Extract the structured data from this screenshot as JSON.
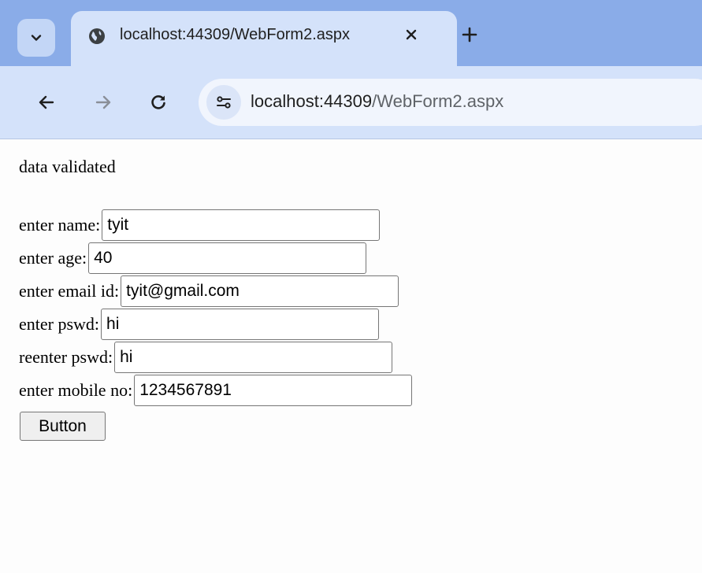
{
  "browser": {
    "tab": {
      "title": "localhost:44309/WebForm2.aspx",
      "favicon": "globe-icon",
      "close_icon": "close-icon"
    },
    "tab_menu_icon": "chevron-down-icon",
    "new_tab_icon": "plus-icon",
    "nav": {
      "back_icon": "arrow-left-icon",
      "forward_icon": "arrow-right-icon",
      "reload_icon": "reload-icon"
    },
    "address_bar": {
      "site_info_icon": "tune-icon",
      "host": "localhost:44309",
      "path": "/WebForm2.aspx"
    },
    "colors": {
      "tabstrip": "#8aace8",
      "active_tab": "#d4e2fa",
      "omnibox": "#f1f5fd"
    }
  },
  "page": {
    "status": "data validated",
    "fields": {
      "name": {
        "label": "enter name:",
        "value": "tyit"
      },
      "age": {
        "label": "enter age:",
        "value": "40"
      },
      "email": {
        "label": "enter email id:",
        "value": "tyit@gmail.com"
      },
      "pswd": {
        "label": "enter pswd:",
        "value": "hi"
      },
      "repswd": {
        "label": "reenter pswd:",
        "value": "hi"
      },
      "mobile": {
        "label": "enter mobile no:",
        "value": "1234567891"
      }
    },
    "submit_label": "Button"
  }
}
